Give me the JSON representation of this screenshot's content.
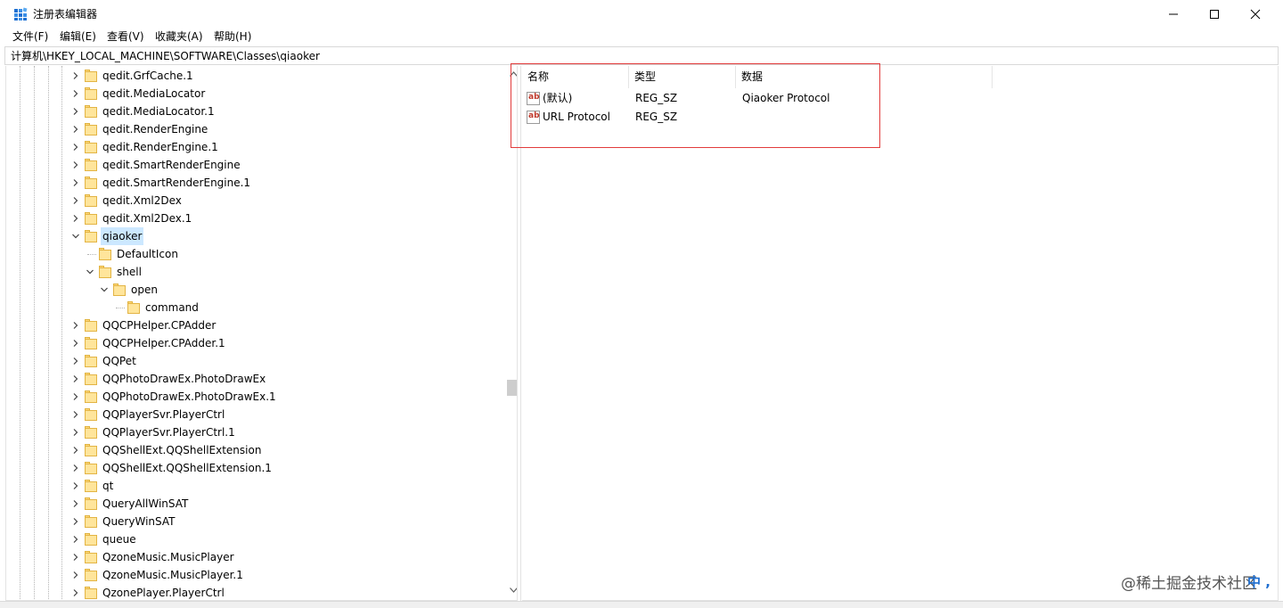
{
  "window": {
    "title": "注册表编辑器"
  },
  "menu": [
    "文件(F)",
    "编辑(E)",
    "查看(V)",
    "收藏夹(A)",
    "帮助(H)"
  ],
  "address": "计算机\\HKEY_LOCAL_MACHINE\\SOFTWARE\\Classes\\qiaoker",
  "tree": [
    {
      "label": "qedit.GrfCache.1",
      "level": 0,
      "expander": "collapsed"
    },
    {
      "label": "qedit.MediaLocator",
      "level": 0,
      "expander": "collapsed"
    },
    {
      "label": "qedit.MediaLocator.1",
      "level": 0,
      "expander": "collapsed"
    },
    {
      "label": "qedit.RenderEngine",
      "level": 0,
      "expander": "collapsed"
    },
    {
      "label": "qedit.RenderEngine.1",
      "level": 0,
      "expander": "collapsed"
    },
    {
      "label": "qedit.SmartRenderEngine",
      "level": 0,
      "expander": "collapsed"
    },
    {
      "label": "qedit.SmartRenderEngine.1",
      "level": 0,
      "expander": "collapsed"
    },
    {
      "label": "qedit.Xml2Dex",
      "level": 0,
      "expander": "collapsed"
    },
    {
      "label": "qedit.Xml2Dex.1",
      "level": 0,
      "expander": "collapsed"
    },
    {
      "label": "qiaoker",
      "level": 0,
      "expander": "expanded",
      "selected": true
    },
    {
      "label": "DefaultIcon",
      "level": 1,
      "expander": "none"
    },
    {
      "label": "shell",
      "level": 1,
      "expander": "expanded"
    },
    {
      "label": "open",
      "level": 2,
      "expander": "expanded"
    },
    {
      "label": "command",
      "level": 3,
      "expander": "none"
    },
    {
      "label": "QQCPHelper.CPAdder",
      "level": 0,
      "expander": "collapsed"
    },
    {
      "label": "QQCPHelper.CPAdder.1",
      "level": 0,
      "expander": "collapsed"
    },
    {
      "label": "QQPet",
      "level": 0,
      "expander": "collapsed"
    },
    {
      "label": "QQPhotoDrawEx.PhotoDrawEx",
      "level": 0,
      "expander": "collapsed"
    },
    {
      "label": "QQPhotoDrawEx.PhotoDrawEx.1",
      "level": 0,
      "expander": "collapsed"
    },
    {
      "label": "QQPlayerSvr.PlayerCtrl",
      "level": 0,
      "expander": "collapsed"
    },
    {
      "label": "QQPlayerSvr.PlayerCtrl.1",
      "level": 0,
      "expander": "collapsed"
    },
    {
      "label": "QQShellExt.QQShellExtension",
      "level": 0,
      "expander": "collapsed"
    },
    {
      "label": "QQShellExt.QQShellExtension.1",
      "level": 0,
      "expander": "collapsed"
    },
    {
      "label": "qt",
      "level": 0,
      "expander": "collapsed"
    },
    {
      "label": "QueryAllWinSAT",
      "level": 0,
      "expander": "collapsed"
    },
    {
      "label": "QueryWinSAT",
      "level": 0,
      "expander": "collapsed"
    },
    {
      "label": "queue",
      "level": 0,
      "expander": "collapsed"
    },
    {
      "label": "QzoneMusic.MusicPlayer",
      "level": 0,
      "expander": "collapsed"
    },
    {
      "label": "QzoneMusic.MusicPlayer.1",
      "level": 0,
      "expander": "collapsed"
    },
    {
      "label": "QzonePlayer.PlayerCtrl",
      "level": 0,
      "expander": "collapsed"
    }
  ],
  "list": {
    "headers": {
      "name": "名称",
      "type": "类型",
      "data": "数据"
    },
    "rows": [
      {
        "icon": "ab",
        "name": "(默认)",
        "type": "REG_SZ",
        "data": "Qiaoker Protocol"
      },
      {
        "icon": "ab",
        "name": "URL Protocol",
        "type": "REG_SZ",
        "data": ""
      }
    ]
  },
  "watermark": "@稀土掘金技术社区",
  "ime": "中 ,",
  "colors": {
    "selection": "#cce8ff",
    "highlight_box": "#e23b3b",
    "folder": "#ffe59b"
  }
}
